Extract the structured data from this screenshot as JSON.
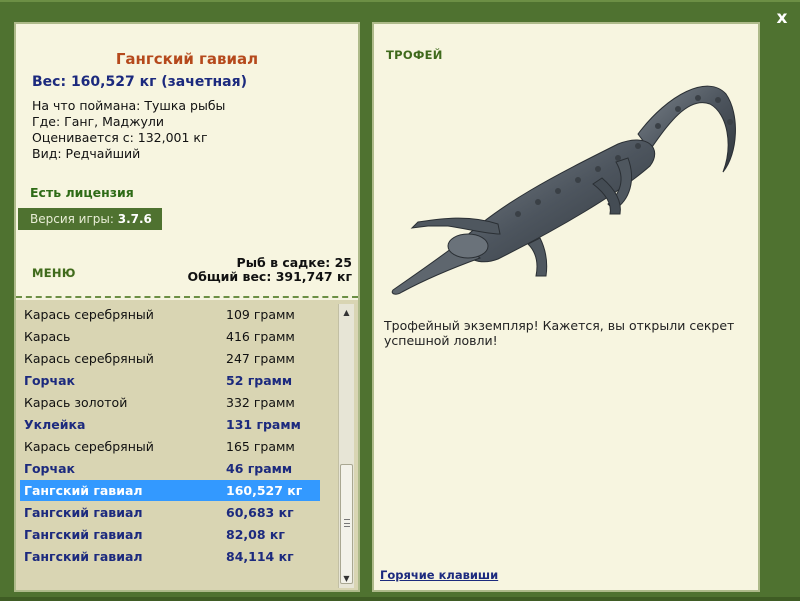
{
  "window": {
    "close_label": "x"
  },
  "info": {
    "fish_name": "Гангский гавиал",
    "weight_line": "Вес: 160,527 кг (зачетная)",
    "caught_on": "На что поймана: Тушка рыбы",
    "location": "Где: Ганг, Маджули",
    "valued_from": "Оценивается с: 132,001 кг",
    "rarity": "Вид: Редчайший",
    "license": "Есть лицензия",
    "version_label": "Версия игры:",
    "version_value": "3.7.6"
  },
  "menu_label": "МЕНЮ",
  "cage": {
    "count_line": "Рыб в садке: 25",
    "total_line": "Общий вес: 391,747 кг"
  },
  "catch_list": [
    {
      "name": "Карась серебряный",
      "weight": "109 грамм",
      "trophy": false,
      "selected": false
    },
    {
      "name": "Карась",
      "weight": "416 грамм",
      "trophy": false,
      "selected": false
    },
    {
      "name": "Карась серебряный",
      "weight": "247 грамм",
      "trophy": false,
      "selected": false
    },
    {
      "name": "Горчак",
      "weight": "52 грамм",
      "trophy": true,
      "selected": false
    },
    {
      "name": "Карась золотой",
      "weight": "332 грамм",
      "trophy": false,
      "selected": false
    },
    {
      "name": "Уклейка",
      "weight": "131 грамм",
      "trophy": true,
      "selected": false
    },
    {
      "name": "Карась серебряный",
      "weight": "165 грамм",
      "trophy": false,
      "selected": false
    },
    {
      "name": "Горчак",
      "weight": "46 грамм",
      "trophy": true,
      "selected": false
    },
    {
      "name": "Гангский гавиал",
      "weight": "160,527 кг",
      "trophy": true,
      "selected": true
    },
    {
      "name": "Гангский гавиал",
      "weight": "60,683 кг",
      "trophy": true,
      "selected": false
    },
    {
      "name": "Гангский гавиал",
      "weight": "82,08 кг",
      "trophy": true,
      "selected": false
    },
    {
      "name": "Гангский гавиал",
      "weight": "84,114 кг",
      "trophy": true,
      "selected": false
    }
  ],
  "trophy_panel": {
    "label": "ТРОФЕЙ",
    "message": "Трофейный экземпляр! Кажется, вы открыли секрет успешной ловли!",
    "hotkeys_link": "Горячие клавиши"
  },
  "colors": {
    "frame_green": "#4f7230",
    "title_orange": "#b5491c",
    "trophy_blue": "#1c2a7e",
    "license_green": "#2e6b16",
    "selection_blue": "#3399ff"
  },
  "icons": {
    "close": "close-icon",
    "scroll_up": "scroll-up-icon",
    "scroll_down": "scroll-down-icon"
  }
}
